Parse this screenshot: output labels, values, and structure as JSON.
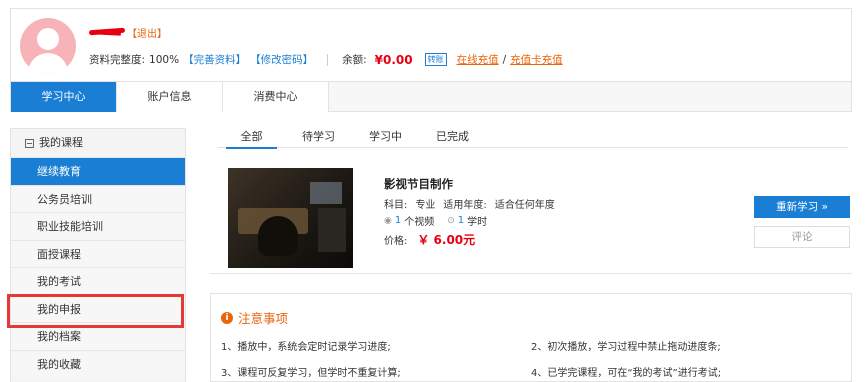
{
  "profile": {
    "logout_label": "【退出】",
    "completeness_label": "资料完整度:",
    "completeness_value": "100%",
    "complete_info_link": "【完善资料】",
    "change_password_link": "【修改密码】",
    "balance_label": "余额:",
    "balance_value": "¥0.00",
    "transfer_label": "转账",
    "online_recharge": "在线充值",
    "divider": "/",
    "card_recharge": "充值卡充值"
  },
  "top_tabs": [
    {
      "label": "学习中心",
      "active": true
    },
    {
      "label": "账户信息",
      "active": false
    },
    {
      "label": "消费中心",
      "active": false
    }
  ],
  "sidebar": {
    "header": "我的课程",
    "items": [
      {
        "label": "继续教育",
        "active": true
      },
      {
        "label": "公务员培训",
        "active": false
      },
      {
        "label": "职业技能培训",
        "active": false
      },
      {
        "label": "面授课程",
        "active": false
      },
      {
        "label": "我的考试",
        "active": false
      },
      {
        "label": "我的申报",
        "active": false
      },
      {
        "label": "我的档案",
        "active": false
      },
      {
        "label": "我的收藏",
        "active": false
      }
    ]
  },
  "main_tabs": [
    {
      "label": "全部",
      "active": true
    },
    {
      "label": "待学习",
      "active": false
    },
    {
      "label": "学习中",
      "active": false
    },
    {
      "label": "已完成",
      "active": false
    }
  ],
  "course": {
    "title": "影视节目制作",
    "subject_label": "科目:",
    "subject_value": "专业",
    "year_label": "适用年度:",
    "year_value": "适合任何年度",
    "video_count": "1",
    "video_unit": "个视频",
    "hours_count": "1",
    "hours_unit": "学时",
    "price_label": "价格:",
    "price_value": "￥ 6.00元",
    "relearn_button": "重新学习 »",
    "comment_button": "评论"
  },
  "notice": {
    "title": "注意事项",
    "items": [
      "1、播放中，系统会定时记录学习进度;",
      "2、初次播放，学习过程中禁止拖动进度条;",
      "3、课程可反复学习，但学时不重复计算;",
      "4、已学完课程，可在“我的考试”进行考试;"
    ]
  },
  "colors": {
    "primary": "#1a7fd4",
    "accent_orange": "#e8650c",
    "price_red": "#e60012",
    "highlight_box": "#e53935"
  }
}
